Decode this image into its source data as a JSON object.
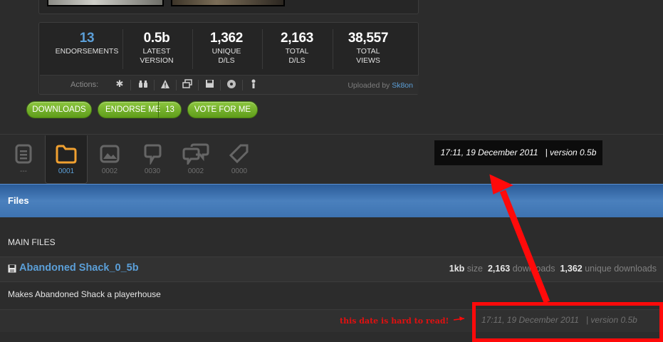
{
  "stats": [
    {
      "value": "13",
      "label_line1": "ENDORSEMENTS",
      "label_line2": ""
    },
    {
      "value": "0.5b",
      "label_line1": "LATEST",
      "label_line2": "VERSION"
    },
    {
      "value": "1,362",
      "label_line1": "UNIQUE",
      "label_line2": "D/LS"
    },
    {
      "value": "2,163",
      "label_line1": "TOTAL",
      "label_line2": "D/LS"
    },
    {
      "value": "38,557",
      "label_line1": "TOTAL",
      "label_line2": "VIEWS"
    }
  ],
  "actions": {
    "label": "Actions:",
    "icons": [
      "gear-icon",
      "binoculars-icon",
      "warning-icon",
      "windows-icon",
      "save-icon",
      "disc-icon",
      "user-icon"
    ],
    "uploaded_prefix": "Uploaded by",
    "uploader": "Sk8on"
  },
  "buttons": {
    "downloads": "DOWNLOADS",
    "endorse": "ENDORSE ME",
    "endorse_count": "13",
    "vote": "VOTE FOR ME"
  },
  "tabs": [
    {
      "icon": "document-icon",
      "count": "---",
      "active": false
    },
    {
      "icon": "folder-icon",
      "count": "0001",
      "active": true
    },
    {
      "icon": "image-icon",
      "count": "0002",
      "active": false
    },
    {
      "icon": "comment-icon",
      "count": "0030",
      "active": false
    },
    {
      "icon": "comments-icon",
      "count": "0002",
      "active": false
    },
    {
      "icon": "tag-icon",
      "count": "0000",
      "active": false
    }
  ],
  "zoomed_date": "17:11, 19 December 2011   | version 0.5b",
  "files_header": "Files",
  "section_title": "MAIN FILES",
  "file": {
    "name": "Abandoned Shack_0_5b",
    "size_value": "1kb",
    "size_label": "size",
    "downloads_value": "2,163",
    "downloads_label": "downloads",
    "unique_value": "1,362",
    "unique_label": "unique downloads",
    "description": "Makes Abandoned Shack a playerhouse",
    "date_version": "17:11, 19 December 2011   | version 0.5b"
  },
  "annotation": {
    "text": "this date is hard to read!",
    "color": "#ff0a0a"
  },
  "colors": {
    "accent_blue": "#5b9fd8",
    "button_green": "#6fae24",
    "active_tab_icon": "#f0a030"
  }
}
